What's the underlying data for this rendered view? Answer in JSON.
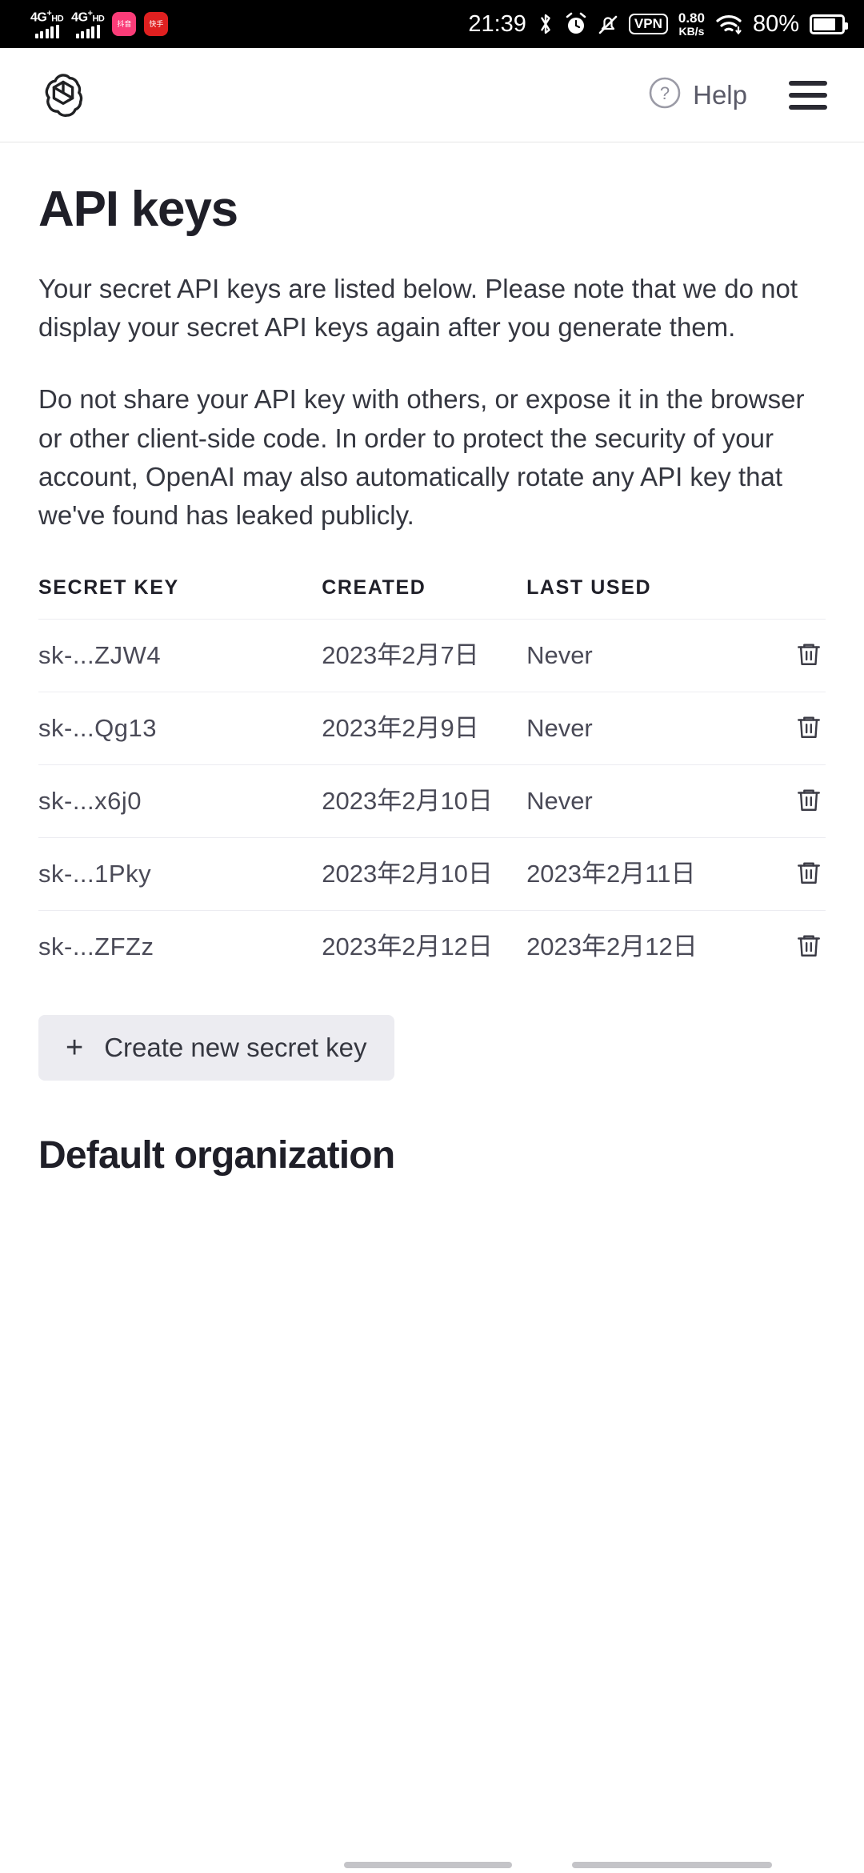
{
  "status_bar": {
    "network_1": {
      "label": "4G",
      "sup": "+",
      "hd": "HD"
    },
    "network_2": {
      "label": "4G",
      "sup": "+",
      "hd": "HD"
    },
    "app_badge_1": "抖音",
    "app_badge_2": "快手",
    "clock": "21:39",
    "bluetooth_icon": "bluetooth-icon",
    "alarm_icon": "alarm-icon",
    "mute_icon": "notifications-silenced-icon",
    "vpn_label": "VPN",
    "net_speed_value": "0.80",
    "net_speed_unit": "KB/s",
    "wifi_icon": "wifi-icon",
    "battery_percent": "80%",
    "battery_level": 80
  },
  "header": {
    "logo_name": "openai-logo",
    "help_label": "Help",
    "help_icon": "question-circle-icon",
    "menu_icon": "hamburger-menu-icon"
  },
  "page": {
    "title": "API keys",
    "paragraph_1": "Your secret API keys are listed below. Please note that we do not display your secret API keys again after you generate them.",
    "paragraph_2": "Do not share your API key with others, or expose it in the browser or other client-side code. In order to protect the security of your account, OpenAI may also automatically rotate any API key that we've found has leaked publicly.",
    "section_heading": "Default organization"
  },
  "table": {
    "columns": [
      "SECRET KEY",
      "CREATED",
      "LAST USED"
    ],
    "rows": [
      {
        "secret_key": "sk-...ZJW4",
        "created": "2023年2月7日",
        "last_used": "Never",
        "delete_icon": "trash-icon"
      },
      {
        "secret_key": "sk-...Qg13",
        "created": "2023年2月9日",
        "last_used": "Never",
        "delete_icon": "trash-icon"
      },
      {
        "secret_key": "sk-...x6j0",
        "created": "2023年2月10日",
        "last_used": "Never",
        "delete_icon": "trash-icon"
      },
      {
        "secret_key": "sk-...1Pky",
        "created": "2023年2月10日",
        "last_used": "2023年2月11日",
        "delete_icon": "trash-icon"
      },
      {
        "secret_key": "sk-...ZFZz",
        "created": "2023年2月12日",
        "last_used": "2023年2月12日",
        "delete_icon": "trash-icon"
      }
    ]
  },
  "actions": {
    "create_key_label": "Create new secret key",
    "create_key_icon": "plus-icon"
  },
  "colors": {
    "background": "#ffffff",
    "text_primary": "#1f1f28",
    "text_secondary": "#353740",
    "text_muted": "#6e6e80",
    "button_bg": "#ececf1",
    "divider": "#ececf1",
    "status_bar_bg": "#000000"
  }
}
